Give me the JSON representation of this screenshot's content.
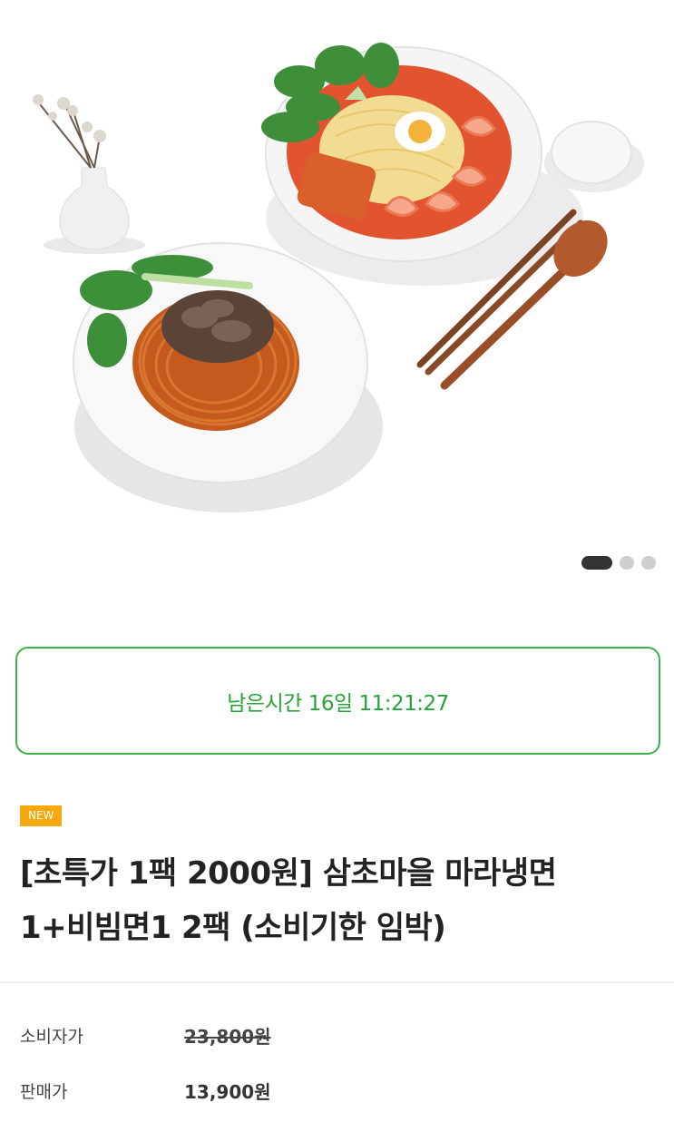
{
  "carousel": {
    "total": 3,
    "active": 0
  },
  "timer": {
    "text": "남은시간 16일 11:21:27"
  },
  "product": {
    "badge": "NEW",
    "title_line1": "[초특가 1팩 2000원] 삼초마을 마라냉면",
    "title_line2": "1+비빔면1 2팩 (소비기한 임박)"
  },
  "prices": {
    "consumer_label": "소비자가",
    "consumer_value": "23,800원",
    "sale_label": "판매가",
    "sale_value": "13,900원"
  },
  "colors": {
    "timer_green": "#27a33a",
    "badge_orange": "#f5a90f"
  }
}
